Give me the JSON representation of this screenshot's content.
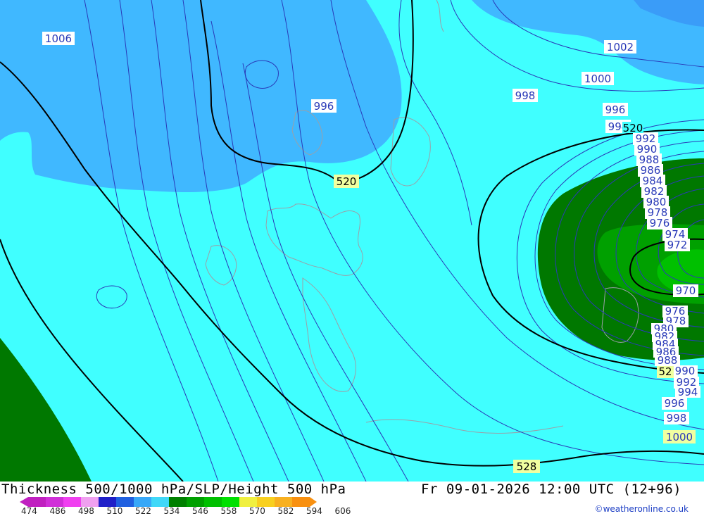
{
  "title_left": "Thickness 500/1000 hPa/SLP/Height 500 hPa",
  "title_right": "Fr 09-01-2026 12:00 UTC (12+96)",
  "credit": "©weatheronline.co.uk",
  "legend": {
    "ticks": [
      "474",
      "486",
      "498",
      "510",
      "522",
      "534",
      "546",
      "558",
      "570",
      "582",
      "594",
      "606"
    ],
    "colors": [
      "#c020c0",
      "#d030d8",
      "#f040f0",
      "#f0a0f0",
      "#2020c8",
      "#2060e0",
      "#38a8f8",
      "#40d8f8",
      "#008000",
      "#00a000",
      "#00c000",
      "#00e000",
      "#f0f040",
      "#f8d020",
      "#f8b020",
      "#f89010"
    ]
  },
  "map": {
    "colors": {
      "cyan": "#40ffff",
      "blue": "#40b8ff",
      "blue_dark": "#3a9cf8",
      "green_dark": "#007800",
      "green": "#00a000",
      "green_light": "#00c000",
      "isobar": "#2a3ab8",
      "coast": "#9aa0a8"
    },
    "isobar_labels": [
      {
        "id": "lbl-1006",
        "text": "1006",
        "style": "blue"
      },
      {
        "id": "lbl-1002",
        "text": "1002",
        "style": "blue"
      },
      {
        "id": "lbl-1000a",
        "text": "1000",
        "style": "blue"
      },
      {
        "id": "lbl-998a",
        "text": "998",
        "style": "blue"
      },
      {
        "id": "lbl-996a",
        "text": "996",
        "style": "blue"
      },
      {
        "id": "lbl-996b",
        "text": "996",
        "style": "blue"
      },
      {
        "id": "lbl-994a",
        "text": "994",
        "style": "blue"
      },
      {
        "id": "lbl-992a",
        "text": "992",
        "style": "blue"
      },
      {
        "id": "lbl-990a",
        "text": "990",
        "style": "blue"
      },
      {
        "id": "lbl-988a",
        "text": "988",
        "style": "blue"
      },
      {
        "id": "lbl-986a",
        "text": "986",
        "style": "blue"
      },
      {
        "id": "lbl-984a",
        "text": "984",
        "style": "blue"
      },
      {
        "id": "lbl-982a",
        "text": "982",
        "style": "blue"
      },
      {
        "id": "lbl-980a",
        "text": "980",
        "style": "blue"
      },
      {
        "id": "lbl-978a",
        "text": "978",
        "style": "blue"
      },
      {
        "id": "lbl-976a",
        "text": "976",
        "style": "blue"
      },
      {
        "id": "lbl-974",
        "text": "974",
        "style": "blue"
      },
      {
        "id": "lbl-972",
        "text": "972",
        "style": "blue"
      },
      {
        "id": "lbl-970",
        "text": "970",
        "style": "blue"
      },
      {
        "id": "lbl-976b",
        "text": "976",
        "style": "blue"
      },
      {
        "id": "lbl-978b",
        "text": "978",
        "style": "blue"
      },
      {
        "id": "lbl-980b",
        "text": "980",
        "style": "blue"
      },
      {
        "id": "lbl-982b",
        "text": "982",
        "style": "blue"
      },
      {
        "id": "lbl-984b",
        "text": "984",
        "style": "blue"
      },
      {
        "id": "lbl-986b",
        "text": "986",
        "style": "blue"
      },
      {
        "id": "lbl-988b",
        "text": "988",
        "style": "blue"
      },
      {
        "id": "lbl-990b",
        "text": "990",
        "style": "blue"
      },
      {
        "id": "lbl-992b",
        "text": "992",
        "style": "blue"
      },
      {
        "id": "lbl-994b",
        "text": "994",
        "style": "blue"
      },
      {
        "id": "lbl-996c",
        "text": "996",
        "style": "blue"
      },
      {
        "id": "lbl-998b",
        "text": "998",
        "style": "blue"
      },
      {
        "id": "lbl-1000b",
        "text": "1000",
        "style": "green"
      }
    ],
    "height_labels": [
      {
        "id": "lbl-520a",
        "text": "520"
      },
      {
        "id": "lbl-520b",
        "text": "520"
      },
      {
        "id": "lbl-528",
        "text": "528"
      },
      {
        "id": "lbl-52",
        "text": "52"
      }
    ]
  }
}
